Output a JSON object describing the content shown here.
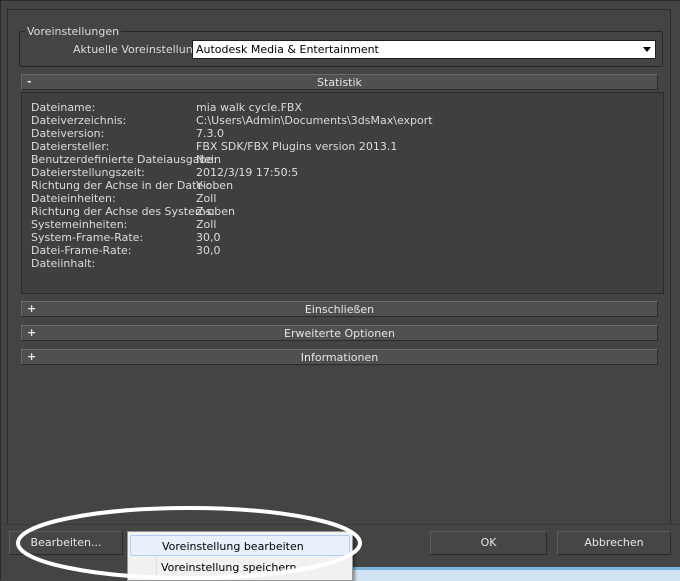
{
  "presets": {
    "group_label": "Voreinstellungen",
    "current_label": "Aktuelle Voreinstellung:",
    "current_value": "Autodesk Media & Entertainment"
  },
  "rollouts": {
    "statistik": {
      "sign": "-",
      "title": "Statistik"
    },
    "einschliessen": {
      "sign": "+",
      "title": "Einschließen"
    },
    "erweitert": {
      "sign": "+",
      "title": "Erweiterte Optionen"
    },
    "info": {
      "sign": "+",
      "title": "Informationen"
    }
  },
  "stats": [
    {
      "key": "Dateiname:",
      "value": "mia walk cycle.FBX"
    },
    {
      "key": "Dateiverzeichnis:",
      "value": "C:\\Users\\Admin\\Documents\\3dsMax\\export"
    },
    {
      "key": "Dateiversion:",
      "value": "7.3.0"
    },
    {
      "key": "Dateiersteller:",
      "value": "FBX SDK/FBX Plugins version 2013.1"
    },
    {
      "key": "Benutzerdefinierte Dateiausgabe:",
      "value": "Nein"
    },
    {
      "key": "Dateierstellungszeit:",
      "value": "2012/3/19  17:50:5"
    },
    {
      "key": "Richtung der Achse in der Datei:",
      "value": "Y-oben"
    },
    {
      "key": "Dateieinheiten:",
      "value": "Zoll"
    },
    {
      "key": "Richtung der Achse des Systems:",
      "value": "Z-oben"
    },
    {
      "key": "Systemeinheiten:",
      "value": "Zoll"
    },
    {
      "key": "System-Frame-Rate:",
      "value": "30,0"
    },
    {
      "key": "Datei-Frame-Rate:",
      "value": "30,0"
    },
    {
      "key": "Dateiinhalt:",
      "value": ""
    }
  ],
  "buttons": {
    "edit": "Bearbeiten...",
    "ok": "OK",
    "cancel": "Abbrechen"
  },
  "context_menu": {
    "items": [
      "Voreinstellung bearbeiten",
      "Voreinstellung speichern"
    ]
  },
  "colors": {
    "background": "#444444",
    "panel": "#3f3f3f",
    "menu_highlight": "#e8f1fb",
    "annotation": "#ffffff"
  }
}
